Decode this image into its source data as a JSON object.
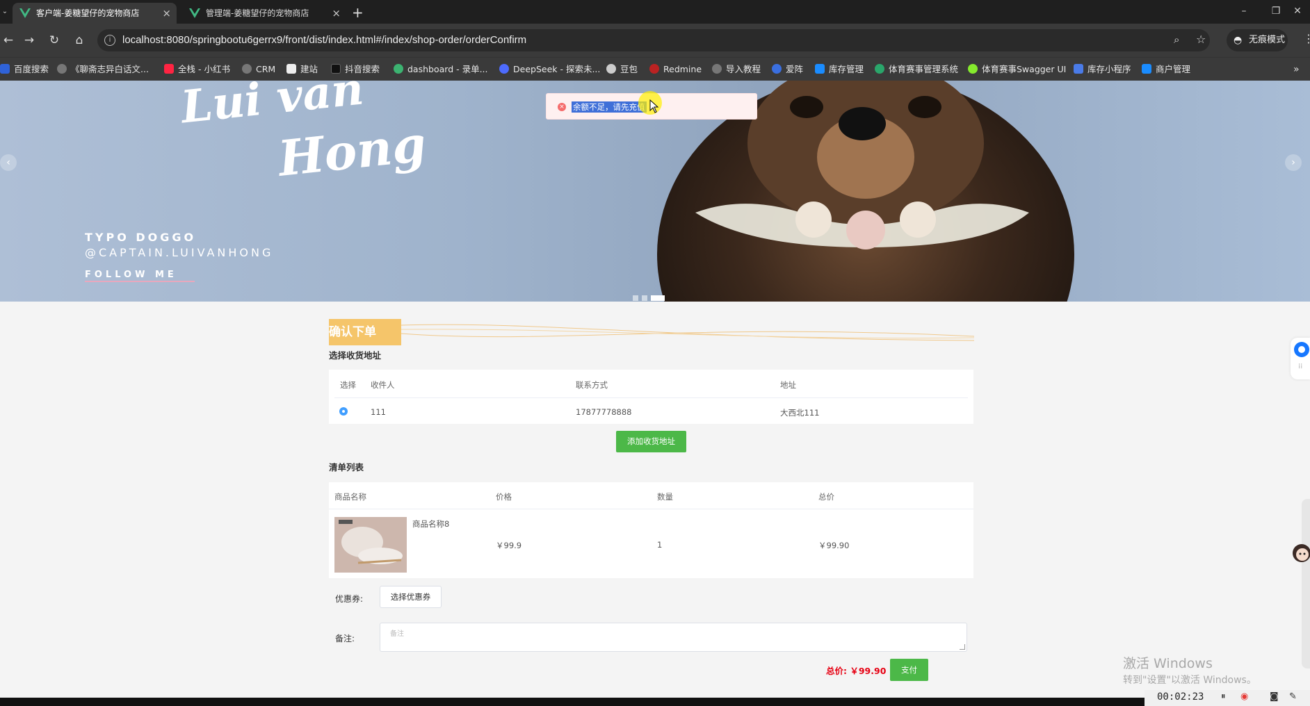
{
  "browser": {
    "tabs": [
      {
        "title": "客户端-姜糖望仔的宠物商店",
        "active": true
      },
      {
        "title": "管理端-姜糖望仔的宠物商店",
        "active": false
      }
    ],
    "url": "localhost:8080/springbootu6gerrx9/front/dist/index.html#/index/shop-order/orderConfirm",
    "incognito_label": "无痕模式",
    "bookmarks": [
      "百度搜索",
      "《聊斋志异白话文...",
      "全栈 - 小红书",
      "CRM",
      "建站",
      "抖音搜索",
      "dashboard - 录单...",
      "DeepSeek - 探索未...",
      "豆包",
      "Redmine",
      "导入教程",
      "爱阵",
      "库存管理",
      "体育赛事管理系统",
      "体育赛事Swagger UI",
      "库存小程序",
      "商户管理"
    ]
  },
  "banner": {
    "script_line1": "Lui van",
    "script_line2": "Hong",
    "typo_line1": "TYPO DOGGO",
    "typo_line2": "@CAPTAIN.LUIVANHONG",
    "follow": "FOLLOW ME",
    "slide_count": 3,
    "active_slide": 3
  },
  "toast": {
    "type": "error",
    "message": "余额不足，请先充值"
  },
  "page": {
    "title": "确认下单",
    "address_heading": "选择收货地址",
    "address_table": {
      "headers": [
        "选择",
        "收件人",
        "联系方式",
        "地址"
      ],
      "rows": [
        {
          "selected": true,
          "name": "111",
          "phone": "17877778888",
          "address": "大西北111"
        }
      ]
    },
    "add_address_button": "添加收货地址",
    "list_heading": "清单列表",
    "items_table": {
      "headers": [
        "商品名称",
        "价格",
        "数量",
        "总价"
      ],
      "rows": [
        {
          "name": "商品名称8",
          "price": "￥99.9",
          "qty": "1",
          "total": "￥99.90"
        }
      ]
    },
    "coupon_label": "优惠券:",
    "coupon_button": "选择优惠券",
    "remark_label": "备注:",
    "remark_placeholder": "备注",
    "total_text": "总价: ￥99.90",
    "pay_button": "支付"
  },
  "watermark": {
    "line1": "激活 Windows",
    "line2": "转到\"设置\"以激活 Windows。"
  },
  "recorder": {
    "time": "00:02:23"
  },
  "colors": {
    "accent_green": "#4cb848",
    "title_orange": "#f5c56a",
    "price_red": "#e60012",
    "radio_blue": "#409eff"
  }
}
